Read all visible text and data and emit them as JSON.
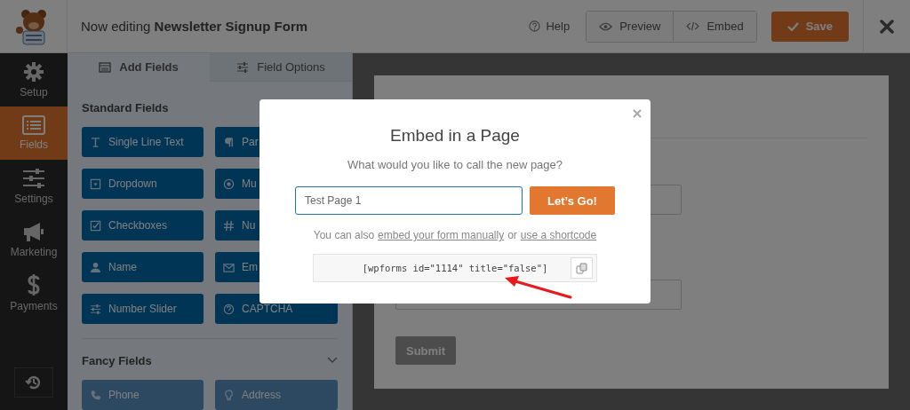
{
  "header": {
    "title": "Now editing **Newsletter Signup Form**",
    "help": "Help",
    "preview": "Preview",
    "embed": "Embed",
    "save": "Save"
  },
  "sidebar": {
    "items": [
      {
        "label": "Setup",
        "selected": false
      },
      {
        "label": "Fields",
        "selected": true
      },
      {
        "label": "Settings",
        "selected": false
      },
      {
        "label": "Marketing",
        "selected": false
      },
      {
        "label": "Payments",
        "selected": false
      }
    ]
  },
  "panel": {
    "tabs": [
      {
        "label": "Add Fields",
        "selected": true
      },
      {
        "label": "Field Options",
        "selected": false
      }
    ],
    "sections": [
      {
        "title": "Standard Fields",
        "fields": [
          "Single Line Text",
          "Par",
          "Dropdown",
          "Mu",
          "Checkboxes",
          "Nu",
          "Name",
          "Em",
          "Number Slider",
          "CAPTCHA"
        ]
      },
      {
        "title": "Fancy Fields",
        "expanded": true,
        "fields": [
          "Phone",
          "Address"
        ]
      }
    ]
  },
  "form_preview": {
    "submit": "Submit"
  },
  "modal": {
    "title": "Embed in a Page",
    "prompt": "What would you like to call the new page?",
    "page_name": "Test Page 1",
    "go": "Let’s Go!",
    "also_prefix": "You can also",
    "link_manual": "embed your form manually",
    "also_or": "or",
    "link_shortcode": "use a shortcode",
    "shortcode": "[wpforms id=\"1114\" title=\"false\"]"
  }
}
